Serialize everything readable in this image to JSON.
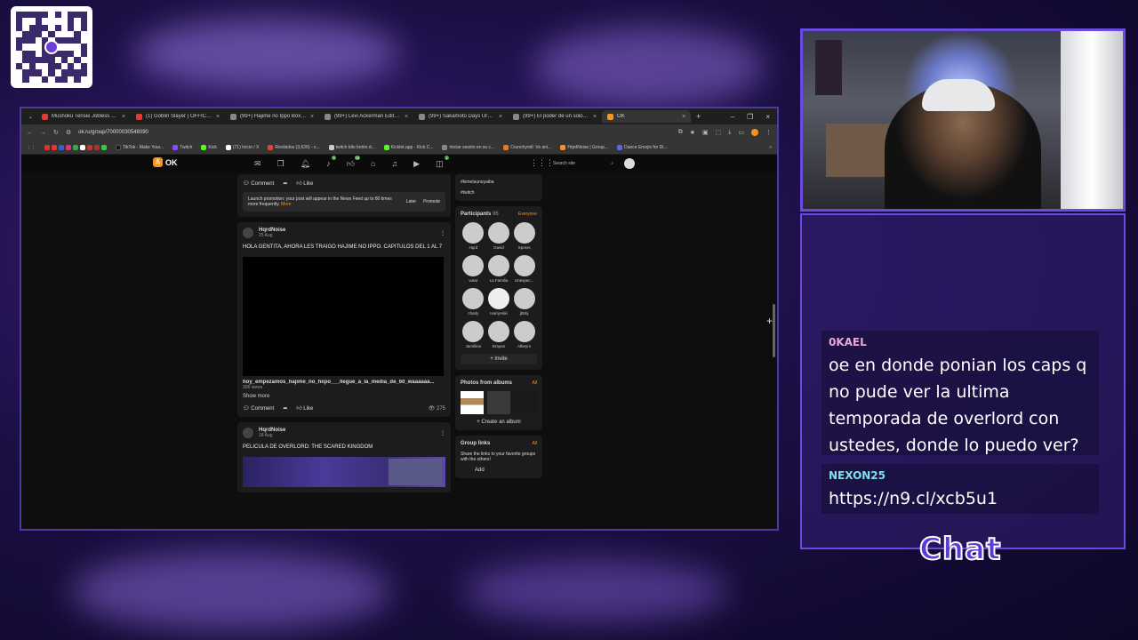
{
  "browser": {
    "tabs": [
      {
        "label": "Mushoku Tensei Jobless Reinca",
        "color": "#e53935"
      },
      {
        "label": "(1) Goblin Slayer | OFFICIAL PR",
        "color": "#e53935"
      },
      {
        "label": "(99+) Hajime no Ippo Boxing A",
        "color": "#888888"
      },
      {
        "label": "(99+) Levi Ackerman Edits Stu",
        "color": "#888888"
      },
      {
        "label": "(99+) Sakamoto Days Urgent I",
        "color": "#888888"
      },
      {
        "label": "(99+) El poder de un solo hech",
        "color": "#888888"
      },
      {
        "label": "OK",
        "color": "#f7931e"
      }
    ],
    "url": "ok.ru/group/70000030548090",
    "bookmarks": [
      "TikTok - Make Your...",
      "Twitch",
      "Kick",
      "(71) Inicio / X",
      "Recibidos (3,626) - c...",
      "twitch bits botón d...",
      "Kicklet.app - Kick C...",
      "Iniciar sesión en su c...",
      "Crunchyroll: Ve ani...",
      "HqrdNoise | Group...",
      "Dance Emojis for Di..."
    ]
  },
  "ok": {
    "logo": "OK",
    "search_placeholder": "Search site",
    "badges": {
      "music": "3",
      "video": "15",
      "games": "1"
    },
    "promo": {
      "comment": "Comment",
      "like": "Like",
      "text": "Launch promotion: your post will appear in the News Feed up to 80 times more frequently.",
      "more": "More",
      "later": "Later",
      "promote": "Promote"
    },
    "post1": {
      "author": "HqrdNoise",
      "date": "25 Aug",
      "text": "HOLA GENTITA, AHORA LES TRAIGO HAJIME NO IPPO. CAPITULOS DEL 1 AL 7",
      "video_title": "hoy_empezamos_hajime_no_hiipo___llegue_a_la_media_de_60_waaaaaa...",
      "views": "306 views",
      "show_more": "Show more",
      "comment": "Comment",
      "like": "Like",
      "view_count": "275"
    },
    "post2": {
      "author": "HqrdNoise",
      "date": "18 Aug",
      "text": "PELICULA DE OVERLORD: THE SCARED KINGDOM"
    },
    "side": {
      "tags": [
        "#kimetsunoyaiba",
        "#twitch"
      ],
      "participants_title": "Participants",
      "participants_count": "96",
      "everyone": "Everyone",
      "participants": [
        "Hqrd",
        "David",
        "Xpress",
        "vutar",
        "La Familia",
        "Unexpec...",
        "charly",
        "HarryHiiki",
        "jbbhj",
        "Jamillion",
        "Brayan",
        "Albeyro"
      ],
      "invite": "Invite",
      "photos_title": "Photos from albums",
      "all": "All",
      "create_album": "Create an album",
      "links_title": "Group links",
      "links_all": "All",
      "links_text": "Share the links to your favorite groups with the others!",
      "add": "Add"
    }
  },
  "chat": {
    "messages": [
      {
        "user": "0KAEL",
        "text": "oe en donde ponian los caps q no pude ver la ultima temporada de overlord con ustedes, donde lo puedo ver?"
      },
      {
        "user": "NEXON25",
        "text": "https://n9.cl/xcb5u1"
      }
    ],
    "label": "Chat"
  },
  "colors": {
    "accent": "#6a4ae0",
    "ok_orange": "#f7931e"
  }
}
